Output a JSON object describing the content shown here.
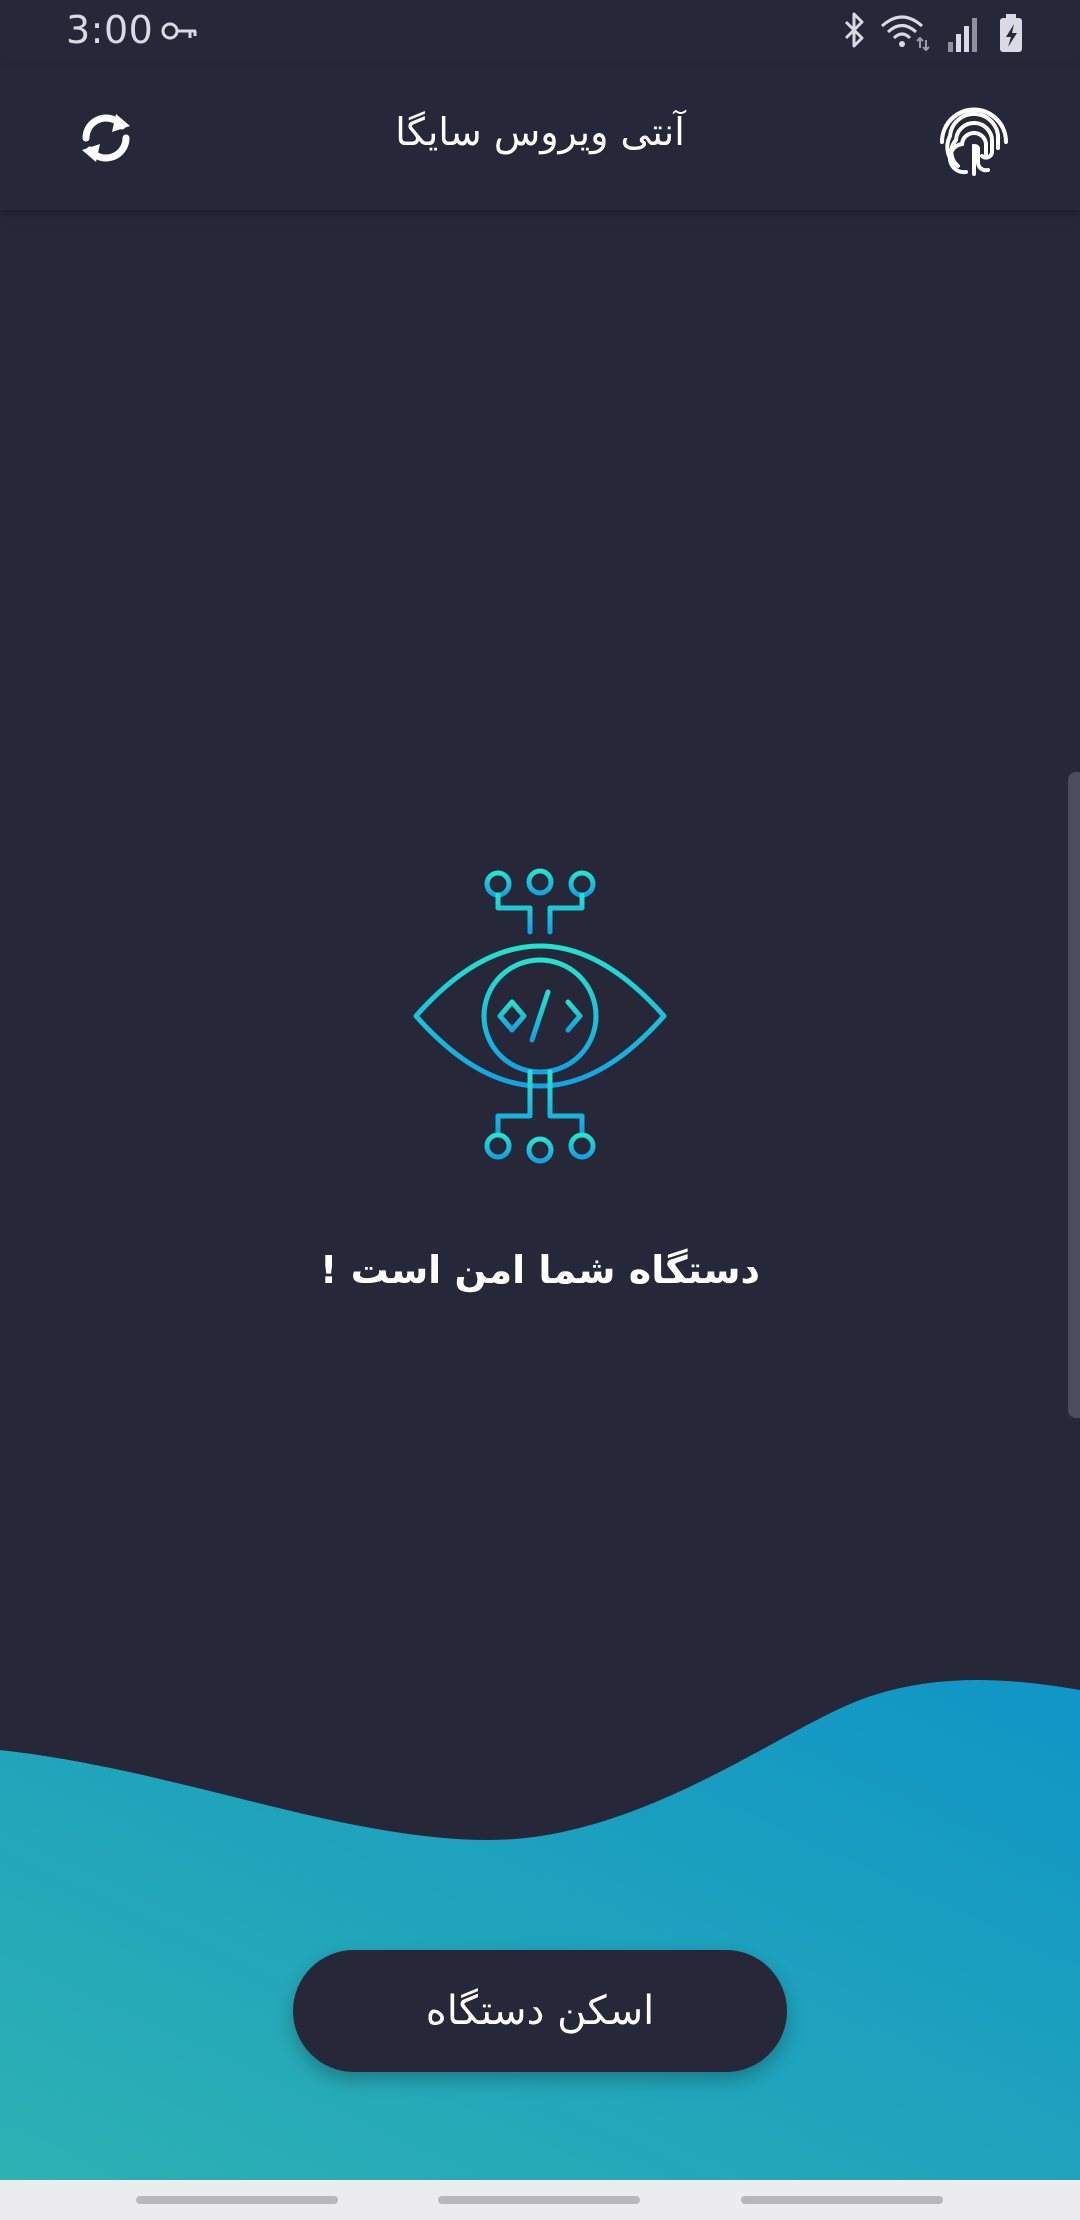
{
  "status_bar": {
    "time": "3:00",
    "icons": [
      "vpn-key-icon",
      "bluetooth-icon",
      "wifi-icon",
      "signal-icon",
      "battery-charging-icon"
    ]
  },
  "app_bar": {
    "title": "آنتی ویروس سایگا",
    "left_icon": "refresh-icon",
    "right_icon": "fingerprint-icon"
  },
  "main": {
    "illustration": "eye-code-icon",
    "message": "دستگاه شما امن است !"
  },
  "scan_button": {
    "label": "اسکن دستگاه"
  },
  "colors": {
    "background": "#262739",
    "accent_cyan": "#22d8d0",
    "accent_blue": "#14a6e0",
    "wave_left": "#2eb1b3",
    "wave_right": "#1095c6"
  }
}
